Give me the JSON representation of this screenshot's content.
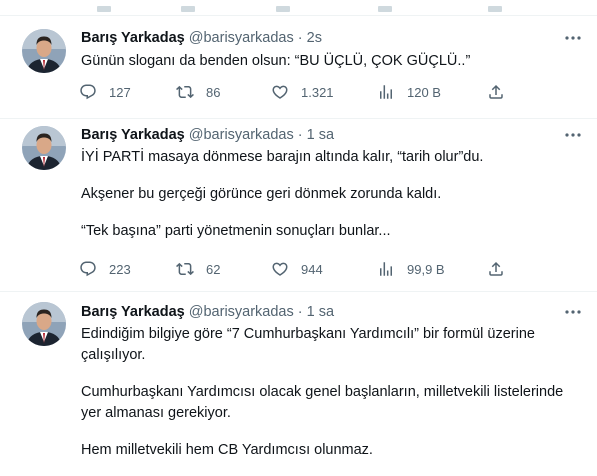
{
  "tweets": [
    {
      "name": "Barış Yarkadaş",
      "handle": "@barisyarkadas",
      "sep": "·",
      "time": "2s",
      "paragraphs": [
        "Günün sloganı da benden olsun: “BU ÜÇLÜ, ÇOK GÜÇLÜ..”"
      ],
      "replies": "127",
      "retweets": "86",
      "likes": "1.321",
      "views": "120 B"
    },
    {
      "name": "Barış Yarkadaş",
      "handle": "@barisyarkadas",
      "sep": "·",
      "time": "1 sa",
      "paragraphs": [
        "İYİ PARTİ masaya dönmese barajın altında kalır, “tarih olur”du.",
        "Akşener bu gerçeği görünce geri dönmek zorunda kaldı.",
        "“Tek başına” parti yönetmenin sonuçları bunlar..."
      ],
      "replies": "223",
      "retweets": "62",
      "likes": "944",
      "views": "99,9 B"
    },
    {
      "name": "Barış Yarkadaş",
      "handle": "@barisyarkadas",
      "sep": "·",
      "time": "1 sa",
      "paragraphs": [
        "Edindiğim bilgiye göre “7 Cumhurbaşkanı Yardımcılı” bir formül üzerine çalışılıyor.",
        "Cumhurbaşkanı Yardımcısı olacak genel başlanların, milletvekili listelerinde yer almanası gerekiyor.",
        "Hem milletvekili hem CB Yardımcısı olunmaz."
      ]
    }
  ],
  "icons": {
    "reply": "reply-icon",
    "retweet": "retweet-icon",
    "like": "heart-icon",
    "views": "views-icon",
    "share": "share-icon",
    "more": "more-dots-icon"
  },
  "colors": {
    "text": "#0f1419",
    "secondary": "#536471",
    "divider": "#eff3f4"
  }
}
